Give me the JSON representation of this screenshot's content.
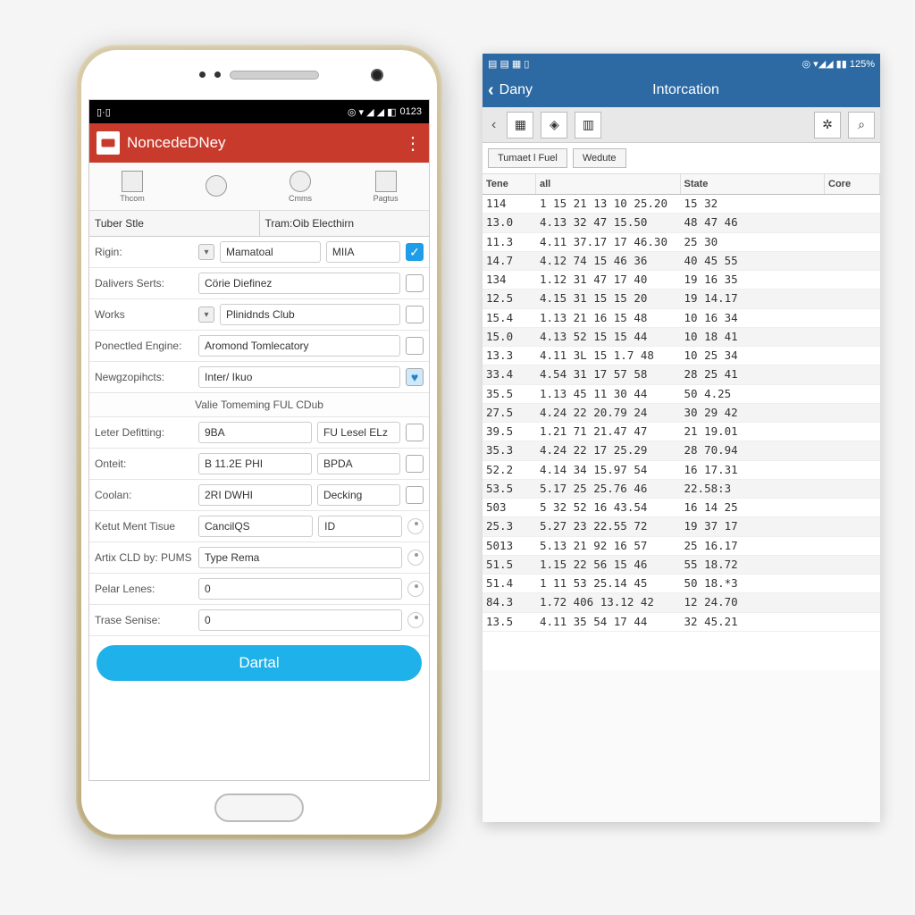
{
  "left": {
    "status_time": "0123",
    "app_title": "NoncedeDNey",
    "tabs": [
      {
        "label": "Thcom"
      },
      {
        "label": ""
      },
      {
        "label": "Cmms"
      },
      {
        "label": "Pagtus"
      }
    ],
    "subtabs": [
      "Tuber Stle",
      "Tram:Oib Electhirn"
    ],
    "rows": [
      {
        "label": "Rigin:",
        "val1": "Mamatoal",
        "val2": "МІІА",
        "checked": true,
        "dd": true
      },
      {
        "label": "Dalivers Serts:",
        "val1": "Cörie Diefinez",
        "checked": false
      },
      {
        "label": "Works",
        "val1": "Plinidnds Club",
        "checked": false,
        "dd": true
      },
      {
        "label": "Ponectled Engine:",
        "val1": "Aromond Tomlecatory",
        "checked": false
      },
      {
        "label": "Newgzopihcts:",
        "val1": "Inter/ Ikuo",
        "favorite": true
      }
    ],
    "divider": "Valie Tomeming FUL CDub",
    "rows2": [
      {
        "label": "Leter Defitting:",
        "val1": "9BA",
        "val2": "FU Lesel ELz",
        "checked": false
      },
      {
        "label": "Onteit:",
        "val1": "B 11.2E PHI",
        "val2": "BPDA",
        "checked": false
      },
      {
        "label": "Coolan:",
        "val1": "2RI DWHI",
        "val2": "Decking",
        "checked": false
      },
      {
        "label": "Ketut Ment Tisue",
        "val1": "CancilQS",
        "val2": "ID",
        "spin": true
      },
      {
        "label": "Artix CLD by:\nPUMS",
        "val1": "Type Rema",
        "spin": true,
        "wide": true
      },
      {
        "label": "Pelar Lenes:",
        "val1": "0",
        "spin": true
      },
      {
        "label": "Trase Senise:",
        "val1": "0",
        "spin": true
      }
    ],
    "button": "Dartal"
  },
  "right": {
    "status_pct": "125%",
    "back_label": "Dany",
    "title": "Intorcation",
    "subtabs": [
      "Tumaet l Fuel",
      "Wedute"
    ],
    "columns": [
      "Tene",
      "all",
      "State",
      "Core"
    ],
    "rows": [
      {
        "t": "114",
        "a": "1 15 21 13 10 25.20",
        "s": "15 32",
        "c": ""
      },
      {
        "t": "13.0",
        "a": "4.13 32 47 15.50",
        "s": "48 47 46",
        "c": ""
      },
      {
        "t": "11.3",
        "a": "4.11 37.17 17 46.30",
        "s": "25 30",
        "c": ""
      },
      {
        "t": "14.7",
        "a": "4.12 74 15 46 36",
        "s": "40 45 55",
        "c": ""
      },
      {
        "t": "134",
        "a": "1.12 31 47 17 40",
        "s": "19 16 35",
        "c": ""
      },
      {
        "t": "12.5",
        "a": "4.15 31 15 15 20",
        "s": "19 14.17",
        "c": ""
      },
      {
        "t": "15.4",
        "a": "1.13 21 16 15 48",
        "s": "10 16 34",
        "c": ""
      },
      {
        "t": "15.0",
        "a": "4.13 52 15 15 44",
        "s": "10 18 41",
        "c": ""
      },
      {
        "t": "13.3",
        "a": "4.11 3L 15 1.7 48",
        "s": "10 25 34",
        "c": ""
      },
      {
        "t": "33.4",
        "a": "4.54 31 17 57 58",
        "s": "28 25 41",
        "c": ""
      },
      {
        "t": "35.5",
        "a": "1.13 45 11 30 44",
        "s": "50 4.25",
        "c": ""
      },
      {
        "t": "27.5",
        "a": "4.24 22 20.79 24",
        "s": "30 29 42",
        "c": ""
      },
      {
        "t": "39.5",
        "a": "1.21 71 21.47 47",
        "s": "21 19.01",
        "c": ""
      },
      {
        "t": "35.3",
        "a": "4.24 22 17 25.29",
        "s": "28 70.94",
        "c": ""
      },
      {
        "t": "52.2",
        "a": "4.14 34 15.97 54",
        "s": "16 17.31",
        "c": ""
      },
      {
        "t": "53.5",
        "a": "5.17 25 25.76 46",
        "s": "22.58:3",
        "c": ""
      },
      {
        "t": "503",
        "a": "5 32 52 16 43.54",
        "s": "16 14 25",
        "c": ""
      },
      {
        "t": "25.3",
        "a": "5.27 23 22.55 72",
        "s": "19 37 17",
        "c": ""
      },
      {
        "t": "5013",
        "a": "5.13 21 92 16 57",
        "s": "25 16.17",
        "c": ""
      },
      {
        "t": "51.5",
        "a": "1.15 22 56 15 46",
        "s": "55 18.72",
        "c": ""
      },
      {
        "t": "51.4",
        "a": "1 11 53 25.14 45",
        "s": "50 18.*3",
        "c": ""
      },
      {
        "t": "84.3",
        "a": "1.72 406 13.12 42",
        "s": "12 24.70",
        "c": ""
      },
      {
        "t": "13.5",
        "a": "4.11 35 54 17 44",
        "s": "32 45.21",
        "c": ""
      }
    ]
  }
}
